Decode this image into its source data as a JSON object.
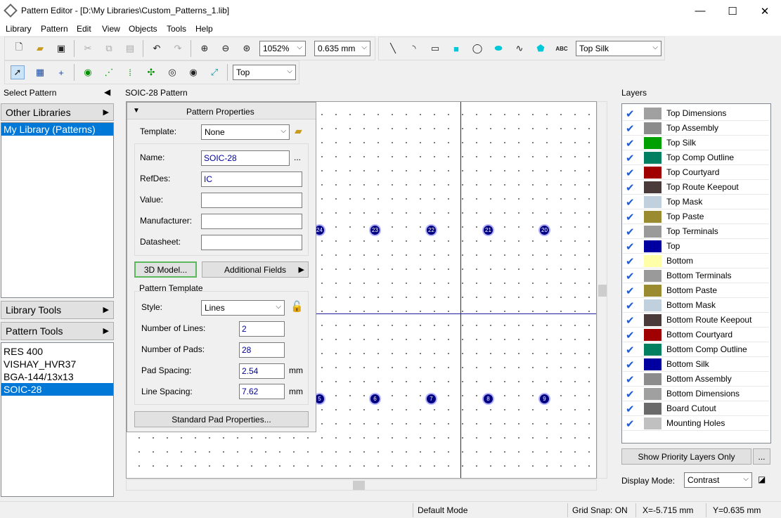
{
  "window": {
    "title": "Pattern Editor - [D:\\My Libraries\\Custom_Patterns_1.lib]",
    "minimize": "—",
    "maximize": "☐",
    "close": "✕"
  },
  "menu": [
    "Library",
    "Pattern",
    "Edit",
    "View",
    "Objects",
    "Tools",
    "Help"
  ],
  "toolbar": {
    "zoom": "1052%",
    "grid": "0.635 mm",
    "layer_combo": "Top Silk",
    "side_combo": "Top",
    "abc_label": "ABC"
  },
  "left": {
    "header": "Select Pattern",
    "other_libraries": "Other Libraries",
    "library_items": [
      "My Library (Patterns)"
    ],
    "library_tools": "Library Tools",
    "pattern_tools": "Pattern Tools",
    "patterns": [
      "RES 400",
      "VISHAY_HVR37",
      "BGA-144/13x13",
      "SOIC-28"
    ]
  },
  "canvas": {
    "title": "SOIC-28 Pattern",
    "top_pads": [
      "24",
      "23",
      "22",
      "21",
      "20"
    ],
    "bottom_pads": [
      "5",
      "6",
      "7",
      "8",
      "9"
    ]
  },
  "props": {
    "header": "Pattern Properties",
    "template_label": "Template:",
    "template_value": "None",
    "name_label": "Name:",
    "name_value": "SOIC-28",
    "name_more": "...",
    "refdes_label": "RefDes:",
    "refdes_value": "IC",
    "value_label": "Value:",
    "value_value": "",
    "manufacturer_label": "Manufacturer:",
    "manufacturer_value": "",
    "datasheet_label": "Datasheet:",
    "datasheet_value": "",
    "model_btn": "3D Model...",
    "fields_btn": "Additional Fields",
    "template_group": "Pattern Template",
    "style_label": "Style:",
    "style_value": "Lines",
    "lines_label": "Number of Lines:",
    "lines_value": "2",
    "pads_label": "Number of Pads:",
    "pads_value": "28",
    "spacing_label": "Pad Spacing:",
    "spacing_value": "2.54",
    "spacing_unit": "mm",
    "linespacing_label": "Line Spacing:",
    "linespacing_value": "7.62",
    "linespacing_unit": "mm",
    "std_pad_btn": "Standard Pad Properties..."
  },
  "layers": {
    "header": "Layers",
    "items": [
      {
        "name": "Top Dimensions",
        "color": "#a0a0a0"
      },
      {
        "name": "Top Assembly",
        "color": "#8c8c8c"
      },
      {
        "name": "Top Silk",
        "color": "#00a000"
      },
      {
        "name": "Top Comp Outline",
        "color": "#008060"
      },
      {
        "name": "Top Courtyard",
        "color": "#a00000"
      },
      {
        "name": "Top Route Keepout",
        "color": "#4a3a3a"
      },
      {
        "name": "Top Mask",
        "color": "#c0d0dc"
      },
      {
        "name": "Top Paste",
        "color": "#9a8a30"
      },
      {
        "name": "Top Terminals",
        "color": "#9a9a9a"
      },
      {
        "name": "Top",
        "color": "#0000a0"
      },
      {
        "name": "Bottom",
        "color": "#ffffa8"
      },
      {
        "name": "Bottom Terminals",
        "color": "#9a9a9a"
      },
      {
        "name": "Bottom Paste",
        "color": "#9a8a30"
      },
      {
        "name": "Bottom Mask",
        "color": "#c0d0dc"
      },
      {
        "name": "Bottom Route Keepout",
        "color": "#4a3a3a"
      },
      {
        "name": "Bottom Courtyard",
        "color": "#a00000"
      },
      {
        "name": "Bottom Comp Outline",
        "color": "#008060"
      },
      {
        "name": "Bottom Silk",
        "color": "#0000a0"
      },
      {
        "name": "Bottom Assembly",
        "color": "#8c8c8c"
      },
      {
        "name": "Bottom Dimensions",
        "color": "#a0a0a0"
      },
      {
        "name": "Board Cutout",
        "color": "#6a6a6a"
      },
      {
        "name": "Mounting Holes",
        "color": "#c0c0c0"
      }
    ],
    "priority_btn": "Show Priority Layers Only",
    "more_btn": "...",
    "display_mode_label": "Display Mode:",
    "display_mode_value": "Contrast"
  },
  "status": {
    "mode": "Default Mode",
    "snap": "Grid Snap: ON",
    "x": "X=-5.715 mm",
    "y": "Y=0.635 mm"
  }
}
